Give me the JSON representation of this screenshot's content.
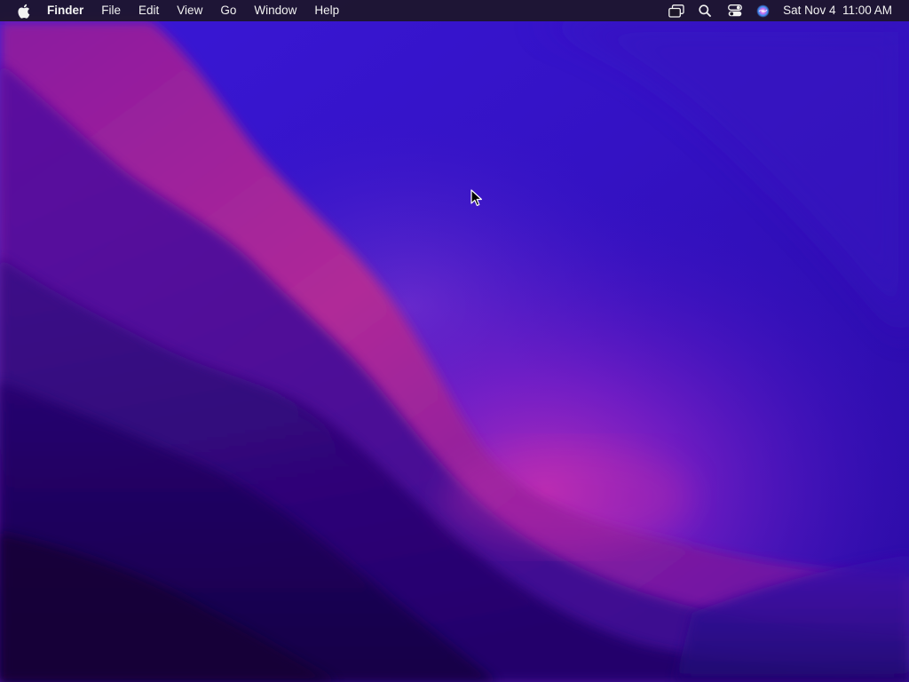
{
  "menubar": {
    "apple_icon": "apple-logo-icon",
    "app_name": "Finder",
    "menus": [
      "File",
      "Edit",
      "View",
      "Go",
      "Window",
      "Help"
    ],
    "status_icons": [
      "screen-mirroring-icon",
      "spotlight-search-icon",
      "control-center-icon",
      "siri-icon"
    ],
    "clock": "Sat Nov 4  11:00 AM"
  },
  "desktop": {
    "wallpaper": "macOS Monterey purple",
    "colors": {
      "sky": "#2d10c8",
      "glow": "#a030d0",
      "pink": "#c0308a",
      "deep": "#1c0660"
    }
  },
  "pointer": {
    "icon": "arrow-pointer-icon"
  }
}
